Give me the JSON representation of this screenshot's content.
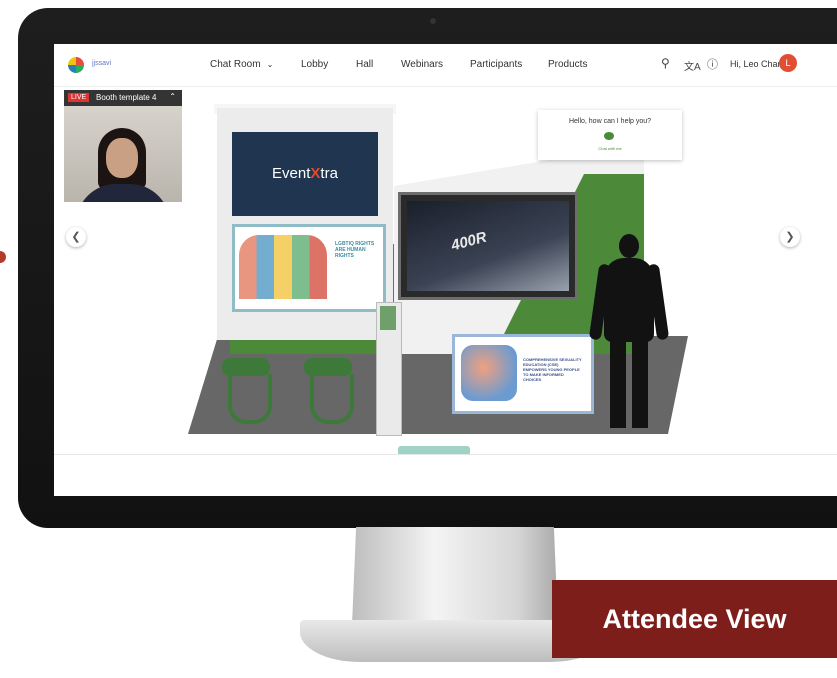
{
  "header": {
    "logo_text": "jjssavi",
    "nav": [
      {
        "label": "Chat Room",
        "dropdown": true
      },
      {
        "label": "Lobby"
      },
      {
        "label": "Hall"
      },
      {
        "label": "Webinars"
      },
      {
        "label": "Participants"
      },
      {
        "label": "Products"
      }
    ],
    "greeting": "Hi, Leo Chan",
    "avatar_initial": "L",
    "icons": [
      "search-icon",
      "translate-icon",
      "help-icon"
    ]
  },
  "video": {
    "live_badge": "LIVE",
    "title": "Booth template 4"
  },
  "booth": {
    "brand": {
      "pre": "Event",
      "x": "X",
      "post": "tra"
    },
    "poster_text": "LGBTIQ RIGHTS ARE HUMAN RIGHTS",
    "tv_text": "400R",
    "low_poster_text": "COMPREHENSIVE SEXUALITY EDUCATION (CSE) EMPOWERS YOUNG PEOPLE TO MAKE INFORMED CHOICES"
  },
  "chat_widget": {
    "question": "Hello, how can I help you?",
    "cta": "Chat with me"
  },
  "overlay_label": "Attendee View",
  "colors": {
    "accent": "#7e1e1b",
    "booth_green": "#4c8a3a",
    "avatar": "#e14e34"
  }
}
